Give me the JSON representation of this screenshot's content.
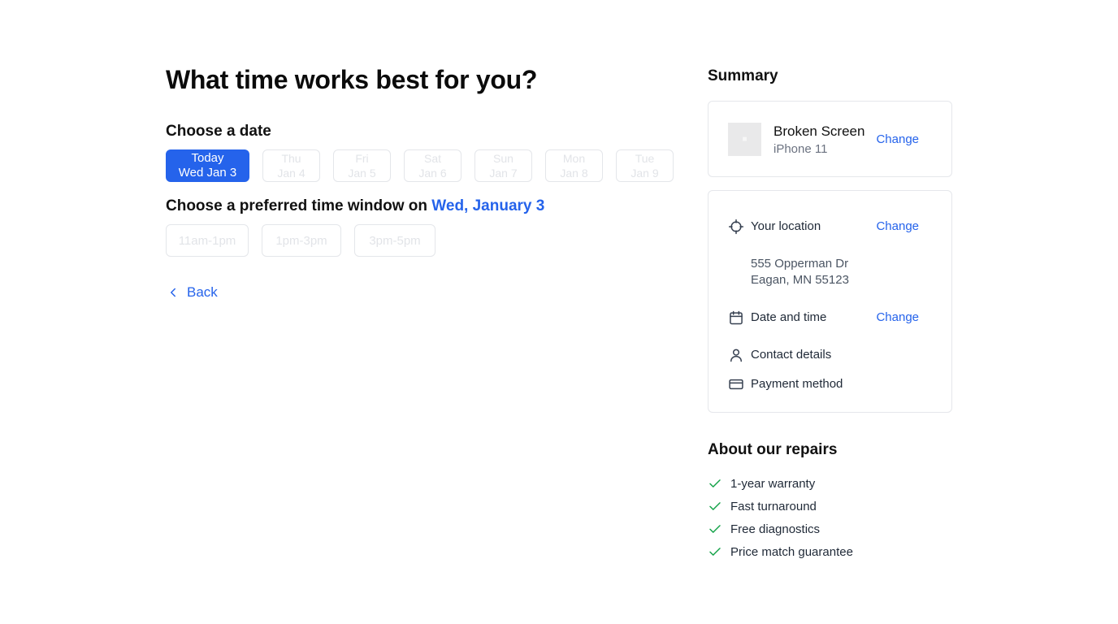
{
  "page": {
    "title": "What time works best for you?"
  },
  "date_section": {
    "label": "Choose a date",
    "dates": [
      {
        "line1": "Today",
        "line2": "Wed Jan 3",
        "selected": true
      },
      {
        "line1": "Thu",
        "line2": "Jan 4",
        "selected": false
      },
      {
        "line1": "Fri",
        "line2": "Jan 5",
        "selected": false
      },
      {
        "line1": "Sat",
        "line2": "Jan 6",
        "selected": false
      },
      {
        "line1": "Sun",
        "line2": "Jan 7",
        "selected": false
      },
      {
        "line1": "Mon",
        "line2": "Jan 8",
        "selected": false
      },
      {
        "line1": "Tue",
        "line2": "Jan 9",
        "selected": false
      }
    ]
  },
  "time_section": {
    "label_prefix": "Choose a preferred time window on",
    "selected_date": "Wed, January 3",
    "windows": [
      "11am-1pm",
      "1pm-3pm",
      "3pm-5pm"
    ]
  },
  "back": {
    "label": "Back",
    "icon": "chevron-left-icon"
  },
  "summary": {
    "title": "Summary",
    "device": {
      "repair": "Broken Screen",
      "model": "iPhone 11",
      "change_label": "Change"
    },
    "location": {
      "label": "Your location",
      "icon": "crosshair-icon",
      "change_label": "Change",
      "address_line1": "555 Opperman Dr",
      "address_line2": "Eagan, MN 55123"
    },
    "datetime": {
      "label": "Date and time",
      "icon": "calendar-icon",
      "change_label": "Change"
    },
    "contact": {
      "label": "Contact details",
      "icon": "person-icon"
    },
    "payment": {
      "label": "Payment method",
      "icon": "credit-card-icon"
    }
  },
  "about": {
    "title": "About our repairs",
    "items": [
      "1-year warranty",
      "Fast turnaround",
      "Free diagnostics",
      "Price match guarantee"
    ],
    "icon": "check-icon"
  },
  "colors": {
    "accent": "#2563eb",
    "check": "#16a34a",
    "border": "#e5e7eb"
  }
}
